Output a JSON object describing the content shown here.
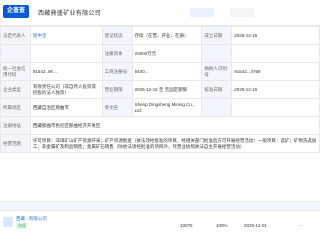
{
  "header": {
    "logo": "企查查",
    "company_name": "西藏鼎盛矿业有限公司",
    "tag_blue": "",
    "tag_gray": ""
  },
  "rows": {
    "legal_rep_label": "法定代表人",
    "legal_rep_value": "程中坚",
    "status_label": "登记状态",
    "status_value": "存续（在营、开业、在册）",
    "found_date_label": "成立日期",
    "found_date_value": "2025-12-15",
    "reg_capital_label": "注册资本",
    "reg_capital_value": "20000万元",
    "credit_code_label": "统一社会信用代码",
    "credit_code_value": "91542..0K...",
    "reg_no_label": "工商注册号",
    "reg_no_value": "5400...",
    "org_code_label": "组织机构代码",
    "org_code_value": "",
    "taxpayer_label": "纳税人识别号",
    "taxpayer_value": "91542...4768",
    "company_type_label": "企业类型",
    "company_type_value": "有限责任公司（非自然人投资或控股的法人独资）",
    "business_term_label": "营业期限",
    "business_term_value": "2025-12-15 至 无固定期限",
    "approval_date_label": "核准日期",
    "approval_date_value": "2025-12-15",
    "region_label": "所属地区",
    "region_value": "西藏自治区那曲市",
    "eng_name_label": "英文名",
    "eng_name_value": "Shenp Dingsheng Mining Co., Ltd.",
    "address_label": "注册地址",
    "address_value": "西藏那曲市色尼区那曲经济开发区"
  },
  "scope": {
    "label": "经营范围",
    "text": "许可项目：非煤矿山矿产资源开采；矿产资源勘查（依法须经批准的项目，经相关部门批准后方可开展经营活动）一般项目：选矿；矿物洗选加工；非金属矿及制品销售；金属矿石销售（除依法须经批准的项目外，凭营业执照依法自主开展经营活动）"
  },
  "shareholder": {
    "name": "西藏...有限公司",
    "tag1": "存续",
    "tag2": "",
    "amount": "10075",
    "percent": "100%",
    "date": "2025-12-01",
    "dash": "-"
  }
}
